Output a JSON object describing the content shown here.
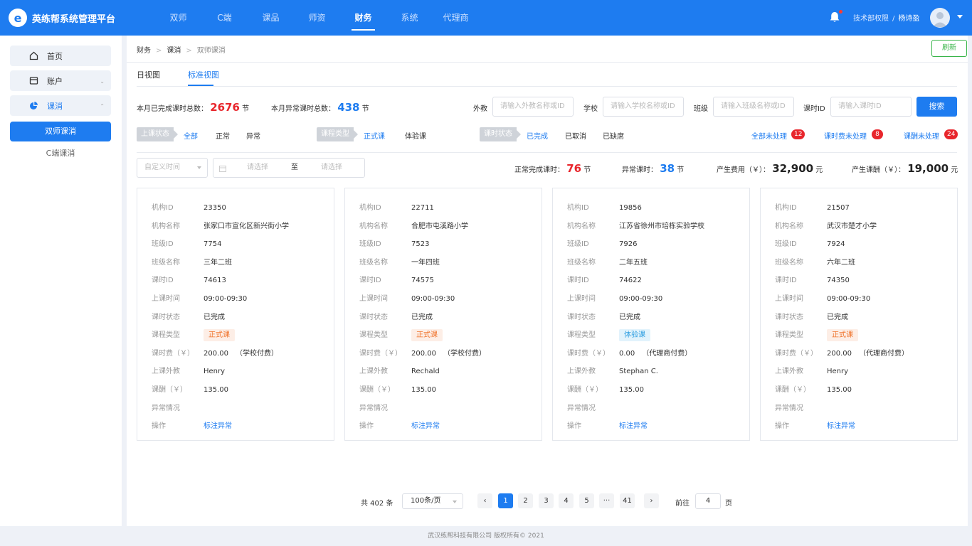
{
  "header": {
    "logo_mark": "e",
    "title": "英练帮系统管理平台",
    "nav": [
      "双师",
      "C端",
      "课品",
      "师资",
      "财务",
      "系统",
      "代理商"
    ],
    "active_nav": 4,
    "dept": "技术部权限",
    "sep": "/",
    "user": "杨诗盈"
  },
  "sidebar": {
    "items": [
      {
        "label": "首页",
        "icon": "home-icon"
      },
      {
        "label": "账户",
        "icon": "wallet-icon",
        "arrow": "⌄"
      },
      {
        "label": "课消",
        "icon": "pie-chart-icon",
        "arrow": "⌃"
      }
    ],
    "sub": [
      {
        "label": "双师课消",
        "active": true
      },
      {
        "label": "C端课消",
        "active": false
      }
    ]
  },
  "breadcrumb": [
    "财务",
    "课消",
    "双师课消"
  ],
  "refresh_label": "刷新",
  "tabs": [
    {
      "label": "日视图",
      "active": false
    },
    {
      "label": "标准视图",
      "active": true
    }
  ],
  "summary": {
    "completed_label": "本月已完成课时总数：",
    "completed_value": "2676",
    "abnormal_label": "本月异常课时总数：",
    "abnormal_value": "438",
    "unit": "节"
  },
  "search": {
    "teacher_label": "外教",
    "teacher_placeholder": "请输入外教名称或ID",
    "school_label": "学校",
    "school_placeholder": "请输入学校名称或ID",
    "class_label": "班级",
    "class_placeholder": "请输入班级名称或ID",
    "lesson_label": "课时ID",
    "lesson_placeholder": "请输入课时ID",
    "button": "搜索"
  },
  "filters": {
    "class_status": {
      "label": "上课状态",
      "options": [
        "全部",
        "正常",
        "异常"
      ],
      "active": 0
    },
    "course_type": {
      "label": "课程类型",
      "options": [
        "正式课",
        "体验课"
      ],
      "active": 0
    },
    "lesson_status": {
      "label": "课时状态",
      "options": [
        "已完成",
        "已取消",
        "已缺席"
      ],
      "active": 0
    },
    "pending": [
      {
        "label": "全部未处理",
        "count": "12"
      },
      {
        "label": "课时费未处理",
        "count": "8"
      },
      {
        "label": "课酬未处理",
        "count": "24"
      }
    ]
  },
  "date_filter": {
    "preset_placeholder": "自定义时间",
    "start_placeholder": "请选择",
    "to": "至",
    "end_placeholder": "请选择"
  },
  "stats": {
    "normal_label": "正常完成课时：",
    "normal_value": "76",
    "abnormal_label": "异常课时：",
    "abnormal_value": "38",
    "lesson_unit": "节",
    "fee_label": "产生费用（￥）：",
    "fee_value": "32,900",
    "pay_label": "产生课酬（￥）：",
    "pay_value": "19,000",
    "money_unit": "元"
  },
  "card_labels": {
    "org_id": "机构ID",
    "org_name": "机构名称",
    "class_id": "班级ID",
    "class_name": "班级名称",
    "lesson_id": "课时ID",
    "time": "上课时间",
    "lesson_status": "课时状态",
    "course_type": "课程类型",
    "fee": "课时费（￥）",
    "teacher": "上课外教",
    "pay": "课酬（￥）",
    "abnormal": "异常情况",
    "action": "操作"
  },
  "cards": [
    {
      "org_id": "23350",
      "org_name": "张家口市宣化区新兴街小学",
      "class_id": "7754",
      "class_name": "三年二班",
      "lesson_id": "74613",
      "time": "09:00-09:30",
      "lesson_status": "已完成",
      "course_type": "正式课",
      "course_color": "orange",
      "fee": "200.00",
      "fee_note": "（学校付费）",
      "teacher": "Henry",
      "pay": "135.00",
      "abnormal": "",
      "action": "标注异常"
    },
    {
      "org_id": "22711",
      "org_name": "合肥市屯溪路小学",
      "class_id": "7523",
      "class_name": "一年四班",
      "lesson_id": "74575",
      "time": "09:00-09:30",
      "lesson_status": "已完成",
      "course_type": "正式课",
      "course_color": "orange",
      "fee": "200.00",
      "fee_note": "（学校付费）",
      "teacher": "Rechald",
      "pay": "135.00",
      "abnormal": "",
      "action": "标注异常"
    },
    {
      "org_id": "19856",
      "org_name": "江苏省徐州市培栋实验学校",
      "class_id": "7926",
      "class_name": "二年五班",
      "lesson_id": "74622",
      "time": "09:00-09:30",
      "lesson_status": "已完成",
      "course_type": "体验课",
      "course_color": "cyan",
      "fee": "0.00",
      "fee_note": "（代理商付费）",
      "teacher": "Stephan C.",
      "pay": "135.00",
      "abnormal": "",
      "action": "标注异常"
    },
    {
      "org_id": "21507",
      "org_name": "武汉市楚才小学",
      "class_id": "7924",
      "class_name": "六年二班",
      "lesson_id": "74350",
      "time": "09:00-09:30",
      "lesson_status": "已完成",
      "course_type": "正式课",
      "course_color": "orange",
      "fee": "200.00",
      "fee_note": "（代理商付费）",
      "teacher": "Henry",
      "pay": "135.00",
      "abnormal": "",
      "action": "标注异常"
    }
  ],
  "pagination": {
    "total": "共 402 条",
    "page_size": "100条/页",
    "prev": "‹",
    "pages": [
      "1",
      "2",
      "3",
      "4",
      "5",
      "···",
      "41"
    ],
    "active_page": 0,
    "next": "›",
    "goto_label": "前往",
    "goto_value": "4",
    "page_label": "页"
  },
  "footer": "武汉练帮科技有限公司 版权所有© 2021",
  "colors": {
    "primary": "#1e7cf0",
    "danger": "#e8262c",
    "success": "#39b54a"
  }
}
